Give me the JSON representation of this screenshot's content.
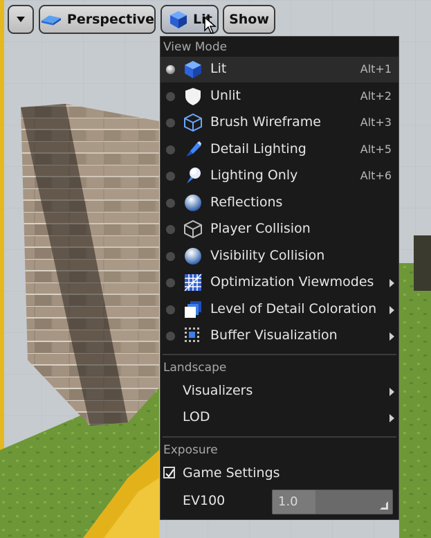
{
  "toolbar": {
    "dropdown_icon": "caret-down-icon",
    "perspective_label": "Perspective",
    "lit_label": "Lit",
    "show_label": "Show"
  },
  "menu": {
    "view_mode_header": "View Mode",
    "view_modes": [
      {
        "label": "Lit",
        "shortcut": "Alt+1",
        "icon": "lit-cube-icon",
        "selected": true
      },
      {
        "label": "Unlit",
        "shortcut": "Alt+2",
        "icon": "unlit-shield-icon"
      },
      {
        "label": "Brush Wireframe",
        "shortcut": "Alt+3",
        "icon": "wireframe-cube-icon"
      },
      {
        "label": "Detail Lighting",
        "shortcut": "Alt+5",
        "icon": "detail-lighting-icon"
      },
      {
        "label": "Lighting Only",
        "shortcut": "Alt+6",
        "icon": "lighting-only-icon"
      },
      {
        "label": "Reflections",
        "shortcut": "",
        "icon": "reflections-sphere-icon"
      },
      {
        "label": "Player Collision",
        "shortcut": "",
        "icon": "player-collision-icon"
      },
      {
        "label": "Visibility Collision",
        "shortcut": "",
        "icon": "visibility-collision-icon"
      },
      {
        "label": "Optimization Viewmodes",
        "shortcut": "",
        "icon": "optimization-grid-icon",
        "submenu": true
      },
      {
        "label": "Level of Detail Coloration",
        "shortcut": "",
        "icon": "lod-coloration-icon",
        "submenu": true
      },
      {
        "label": "Buffer Visualization",
        "shortcut": "",
        "icon": "buffer-visualization-icon",
        "submenu": true
      }
    ],
    "landscape_header": "Landscape",
    "landscape_items": [
      {
        "label": "Visualizers",
        "submenu": true
      },
      {
        "label": "LOD",
        "submenu": true
      }
    ],
    "exposure_header": "Exposure",
    "game_settings_label": "Game Settings",
    "game_settings_checked": true,
    "ev100_label": "EV100",
    "ev100_value": "1.0"
  },
  "colors": {
    "menu_bg": "#1a1a1a",
    "accent_blue": "#2f6fe0",
    "sky": "#8fb0c9",
    "grass": "#6f9a3a",
    "road_yellow": "#e3b21b"
  }
}
